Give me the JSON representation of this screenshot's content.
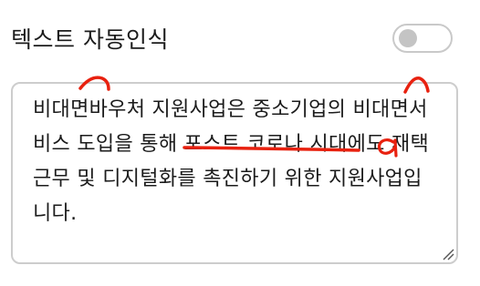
{
  "header": {
    "title": "텍스트 자동인식"
  },
  "toggle": {
    "state": "off"
  },
  "textbox": {
    "text": "비대면바우처 지원사업은 중소기업의 비대면서\n비스 도입을 통해 포스트 코로나 시대에도 재택\n근무 및 디지털화를 촉진하기 위한 지원사업입\n니다."
  },
  "colors": {
    "annotation": "#e8210f",
    "toggle_border": "#c9c9c9",
    "knob": "#c4c4c4",
    "textbox_border": "#cdcdcd"
  },
  "icons": {
    "resize": "resize-grip-icon"
  }
}
